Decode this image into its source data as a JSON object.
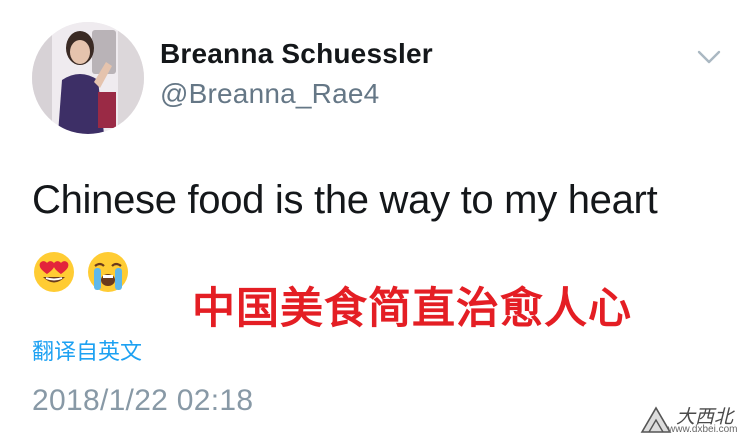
{
  "tweet": {
    "author": {
      "display_name": "Breanna Schuessler",
      "handle": "@Breanna_Rae4"
    },
    "text": "Chinese food is the way to my heart",
    "emojis": [
      "heart-eyes",
      "loudly-crying"
    ],
    "translate_label": "翻译自英文",
    "timestamp": "2018/1/22 02:18"
  },
  "overlay": {
    "caption": "中国美食简直治愈人心",
    "color": "#e41e24"
  },
  "watermark": {
    "title": "大西北",
    "url": "www.dxbei.com"
  },
  "colors": {
    "text": "#14171a",
    "muted": "#657786",
    "link": "#1da1f2"
  }
}
